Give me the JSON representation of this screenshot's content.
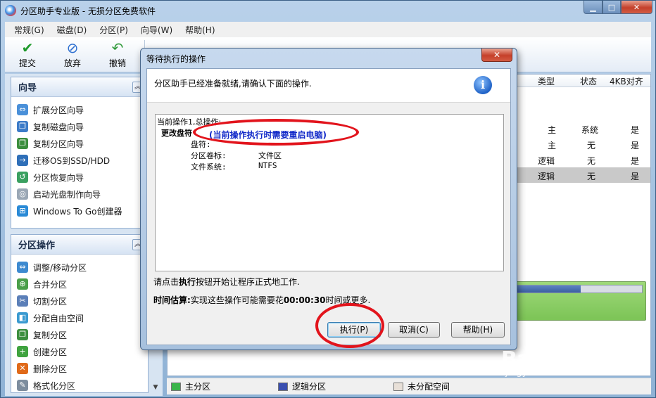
{
  "window": {
    "title": "分区助手专业版 - 无损分区免费软件",
    "controls": {
      "minimize": "▁",
      "maximize": "□",
      "close": "✕"
    }
  },
  "menu": [
    "常规(G)",
    "磁盘(D)",
    "分区(P)",
    "向导(W)",
    "帮助(H)"
  ],
  "toolbar": {
    "commit": {
      "label": "提交",
      "icon": "check-icon"
    },
    "discard": {
      "label": "放弃",
      "icon": "discard-icon"
    },
    "undo": {
      "label": "撤销",
      "icon": "undo-icon"
    }
  },
  "wizard_panel": {
    "title": "向导",
    "items": [
      {
        "label": "扩展分区向导",
        "icon": "extend-icon"
      },
      {
        "label": "复制磁盘向导",
        "icon": "copy-disk-icon"
      },
      {
        "label": "复制分区向导",
        "icon": "copy-partition-icon"
      },
      {
        "label": "迁移OS到SSD/HDD",
        "icon": "migrate-icon"
      },
      {
        "label": "分区恢复向导",
        "icon": "recover-icon"
      },
      {
        "label": "启动光盘制作向导",
        "icon": "bootdisk-icon"
      },
      {
        "label": "Windows To Go创建器",
        "icon": "windows-icon"
      }
    ]
  },
  "partition_panel": {
    "title": "分区操作",
    "items": [
      {
        "label": "调整/移动分区",
        "icon": "resize-icon"
      },
      {
        "label": "合并分区",
        "icon": "merge-icon"
      },
      {
        "label": "切割分区",
        "icon": "split-icon"
      },
      {
        "label": "分配自由空间",
        "icon": "allocate-icon"
      },
      {
        "label": "复制分区",
        "icon": "copy-icon"
      },
      {
        "label": "创建分区",
        "icon": "create-icon"
      },
      {
        "label": "删除分区",
        "icon": "delete-icon"
      },
      {
        "label": "格式化分区",
        "icon": "format-icon"
      }
    ]
  },
  "table": {
    "columns": [
      "类型",
      "状态",
      "4KB对齐"
    ],
    "rows": [
      {
        "type": "主",
        "status": "系统",
        "aligned": "是",
        "selected": false
      },
      {
        "type": "主",
        "status": "无",
        "aligned": "是",
        "selected": false
      },
      {
        "type": "逻辑",
        "status": "无",
        "aligned": "是",
        "selected": false
      },
      {
        "type": "逻辑",
        "status": "无",
        "aligned": "是",
        "selected": true
      }
    ]
  },
  "disk_usage_fraction": 0.56,
  "legend": [
    "主分区",
    "逻辑分区",
    "未分配空间"
  ],
  "legend_colors": [
    "#3bb54a",
    "#3a4fb0",
    "#e8e0d8"
  ],
  "dialog": {
    "title": "等待执行的操作",
    "close": "✕",
    "message": "分区助手已经准备就绪,请确认下面的操作.",
    "op_header": "当前操作1,总操作:",
    "op_name": "更改盘符",
    "op_note": "(当前操作执行时需要重启电脑)",
    "details": [
      {
        "key": "盘符:",
        "value": ""
      },
      {
        "key": "分区卷标:",
        "value": "文件区"
      },
      {
        "key": "文件系统:",
        "value": "NTFS"
      }
    ],
    "hint_prefix": "请点击",
    "hint_bold": "执行",
    "hint_suffix": "按钮开始让程序正式地工作.",
    "estimate_label": "时间估算:",
    "estimate_prefix": "实现这些操作可能需要花",
    "estimate_time": "00:00:30",
    "estimate_suffix": "时间或更多.",
    "buttons": {
      "execute": "执行(P)",
      "cancel": "取消(C)",
      "help": "帮助(H)"
    }
  },
  "watermark": {
    "brand": "Baidu经验",
    "url": "jingyan.baidu.com"
  }
}
